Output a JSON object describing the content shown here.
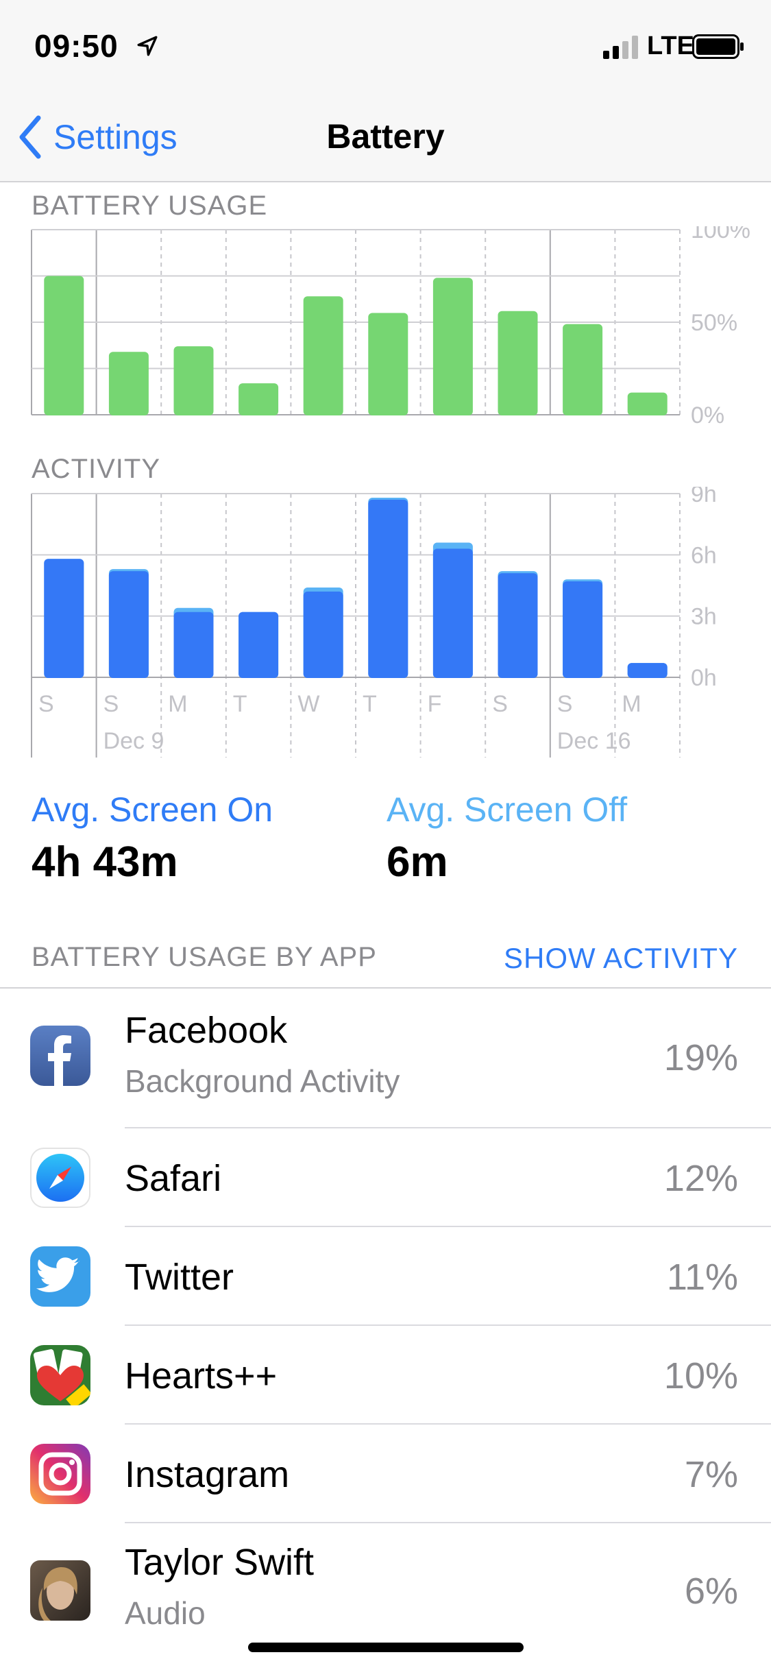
{
  "status_bar": {
    "time": "09:50",
    "network": "LTE"
  },
  "nav": {
    "back_label": "Settings",
    "title": "Battery"
  },
  "battery_chart": {
    "header": "BATTERY USAGE",
    "y_ticks": [
      "100%",
      "50%",
      "0%"
    ],
    "color": "#76d672"
  },
  "activity_chart": {
    "header": "ACTIVITY",
    "y_ticks": [
      "9h",
      "6h",
      "3h",
      "0h"
    ],
    "on_color": "#3478f6",
    "off_color": "#5ab3f5",
    "day_labels": [
      "S",
      "S",
      "M",
      "T",
      "W",
      "T",
      "F",
      "S",
      "S",
      "M"
    ],
    "date_labels": [
      "Dec 9",
      "Dec 16"
    ]
  },
  "chart_data": [
    {
      "type": "bar",
      "title": "BATTERY USAGE",
      "categories": [
        "S",
        "S",
        "M",
        "T",
        "W",
        "T",
        "F",
        "S",
        "S",
        "M"
      ],
      "values": [
        75,
        34,
        37,
        17,
        64,
        55,
        74,
        56,
        49,
        12
      ],
      "ylim": [
        0,
        100
      ],
      "y_ticks": [
        "0%",
        "50%",
        "100%"
      ]
    },
    {
      "type": "bar",
      "title": "ACTIVITY",
      "categories": [
        "S",
        "S",
        "M",
        "T",
        "W",
        "T",
        "F",
        "S",
        "S",
        "M"
      ],
      "stacked": true,
      "series": [
        {
          "values": [
            5.8,
            5.2,
            3.2,
            3.2,
            4.2,
            8.7,
            6.3,
            5.1,
            4.7,
            0.7
          ]
        },
        {
          "values": [
            0.0,
            0.1,
            0.2,
            0.0,
            0.2,
            0.1,
            0.3,
            0.1,
            0.1,
            0.0
          ]
        }
      ],
      "ylim": [
        0,
        9
      ],
      "y_ticks": [
        "0h",
        "3h",
        "6h",
        "9h"
      ],
      "date_labels": [
        "Dec 9",
        "Dec 16"
      ]
    }
  ],
  "summary": {
    "screen_on_label": "Avg. Screen On",
    "screen_on_value": "4h 43m",
    "screen_off_label": "Avg. Screen Off",
    "screen_off_value": "6m"
  },
  "apps_section": {
    "header": "BATTERY USAGE BY APP",
    "action": "SHOW ACTIVITY"
  },
  "apps": [
    {
      "name": "Facebook",
      "sub": "Background Activity",
      "pct": "19%",
      "icon": "facebook-icon"
    },
    {
      "name": "Safari",
      "sub": "",
      "pct": "12%",
      "icon": "safari-icon"
    },
    {
      "name": "Twitter",
      "sub": "",
      "pct": "11%",
      "icon": "twitter-icon"
    },
    {
      "name": "Hearts++",
      "sub": "",
      "pct": "10%",
      "icon": "hearts-icon"
    },
    {
      "name": "Instagram",
      "sub": "",
      "pct": "7%",
      "icon": "instagram-icon"
    },
    {
      "name": "Taylor Swift",
      "sub": "Audio",
      "pct": "6%",
      "icon": "album-art-icon"
    }
  ],
  "colors": {
    "accent": "#2f7cf6",
    "accent_light": "#5ab3f5",
    "secondary_text": "#8a8a8e"
  }
}
